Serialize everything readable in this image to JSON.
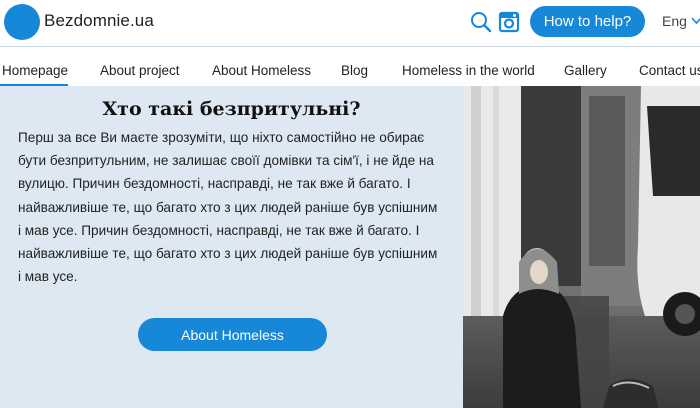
{
  "header": {
    "logo_text": "Bezdomnie.ua",
    "help_button": "How to help?",
    "language": "Eng"
  },
  "nav": {
    "items": [
      {
        "label": "Homepage",
        "active": true
      },
      {
        "label": "About project",
        "active": false
      },
      {
        "label": "About Homeless",
        "active": false
      },
      {
        "label": "Blog",
        "active": false
      },
      {
        "label": "Homeless in the world",
        "active": false
      },
      {
        "label": "Gallery",
        "active": false
      },
      {
        "label": "Contact us",
        "active": false
      }
    ]
  },
  "main": {
    "title": "Хто такі безпритульні?",
    "paragraph_lines": [
      "Перш за все Ви маєте зрозуміти, що ніхто самостійно не обирає",
      "бути безпритульним, не залишає своїї домівки та сім'ї, і не йде на",
      "вулицю. Причин бездомності, насправді, не так вже й багато. І",
      "найважливіше те, що багато хто з цих людей раніше був успішним",
      "і мав усе. Причин бездомності, насправді, не так вже й багато. І",
      "найважливіше те, що багато хто з цих людей раніше був успішним",
      "і мав усе."
    ],
    "button_label": "About Homeless"
  },
  "icons": [
    "search-icon",
    "instagram-icon",
    "chevron-down-icon"
  ],
  "colors": {
    "accent": "#1787d8",
    "content_background": "#dde8f3"
  }
}
